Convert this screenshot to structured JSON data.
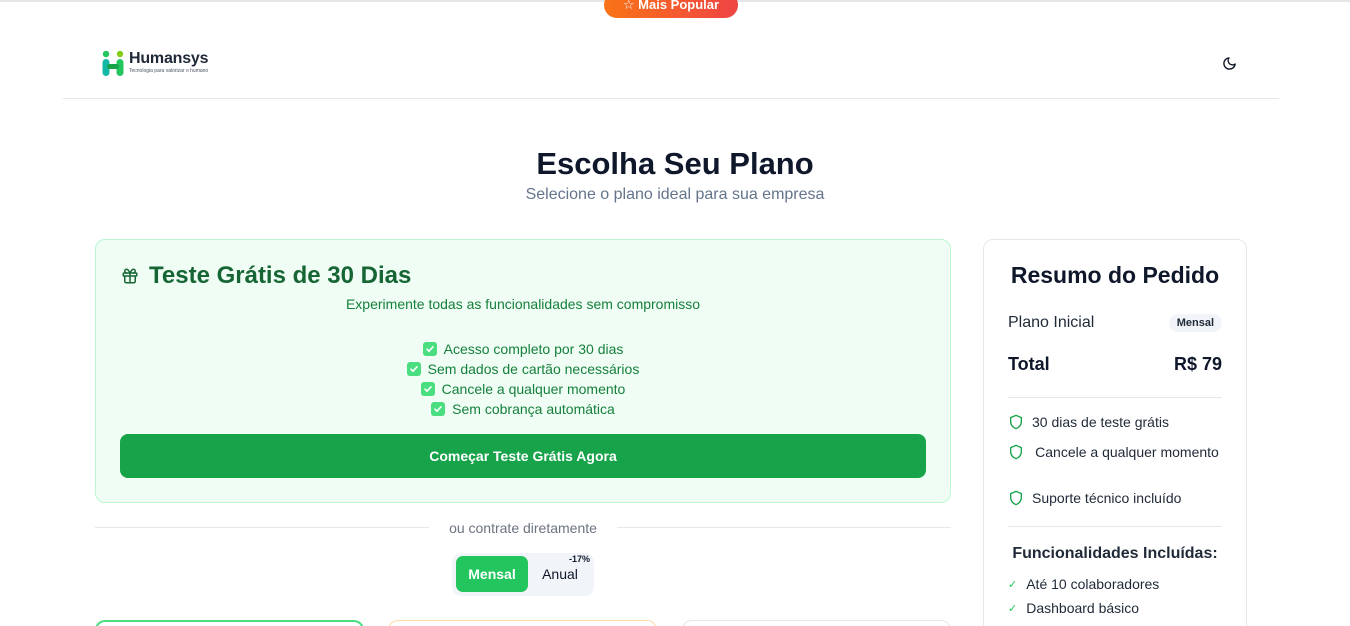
{
  "badge": {
    "popular": "☆ Mais Popular"
  },
  "header": {
    "logo_name": "Humansys",
    "logo_tagline": "Tecnologia para valorizar o humano",
    "theme_icon": "moon-icon"
  },
  "hero": {
    "title": "Escolha Seu Plano",
    "subtitle": "Selecione o plano ideal para sua empresa"
  },
  "trial": {
    "icon": "gift-icon",
    "title": "Teste Grátis de 30 Dias",
    "subtitle": "Experimente todas as funcionalidades sem compromisso",
    "items": [
      "Acesso completo por 30 dias",
      "Sem dados de cartão necessários",
      "Cancele a qualquer momento",
      "Sem cobrança automática"
    ],
    "button": "Começar Teste Grátis Agora"
  },
  "divider": {
    "text": "ou contrate diretamente"
  },
  "billing": {
    "monthly": "Mensal",
    "annual": "Anual",
    "discount": "-17%"
  },
  "summary": {
    "title": "Resumo do Pedido",
    "plan_name": "Plano Inicial",
    "plan_badge": "Mensal",
    "total_label": "Total",
    "total_value": "R$ 79",
    "guarantees": [
      "30 dias de teste grátis",
      "Cancele a qualquer momento",
      "Suporte técnico incluído"
    ],
    "features_title": "Funcionalidades Incluídas:",
    "features": [
      "Até 10 colaboradores",
      "Dashboard básico"
    ]
  },
  "colors": {
    "primary": "#16a34a",
    "toggle_active": "#22c55e",
    "trial_bg": "#f0fdf4",
    "trial_title": "#166534",
    "popular_gradient_start": "#f97316",
    "popular_gradient_end": "#ef4444"
  }
}
